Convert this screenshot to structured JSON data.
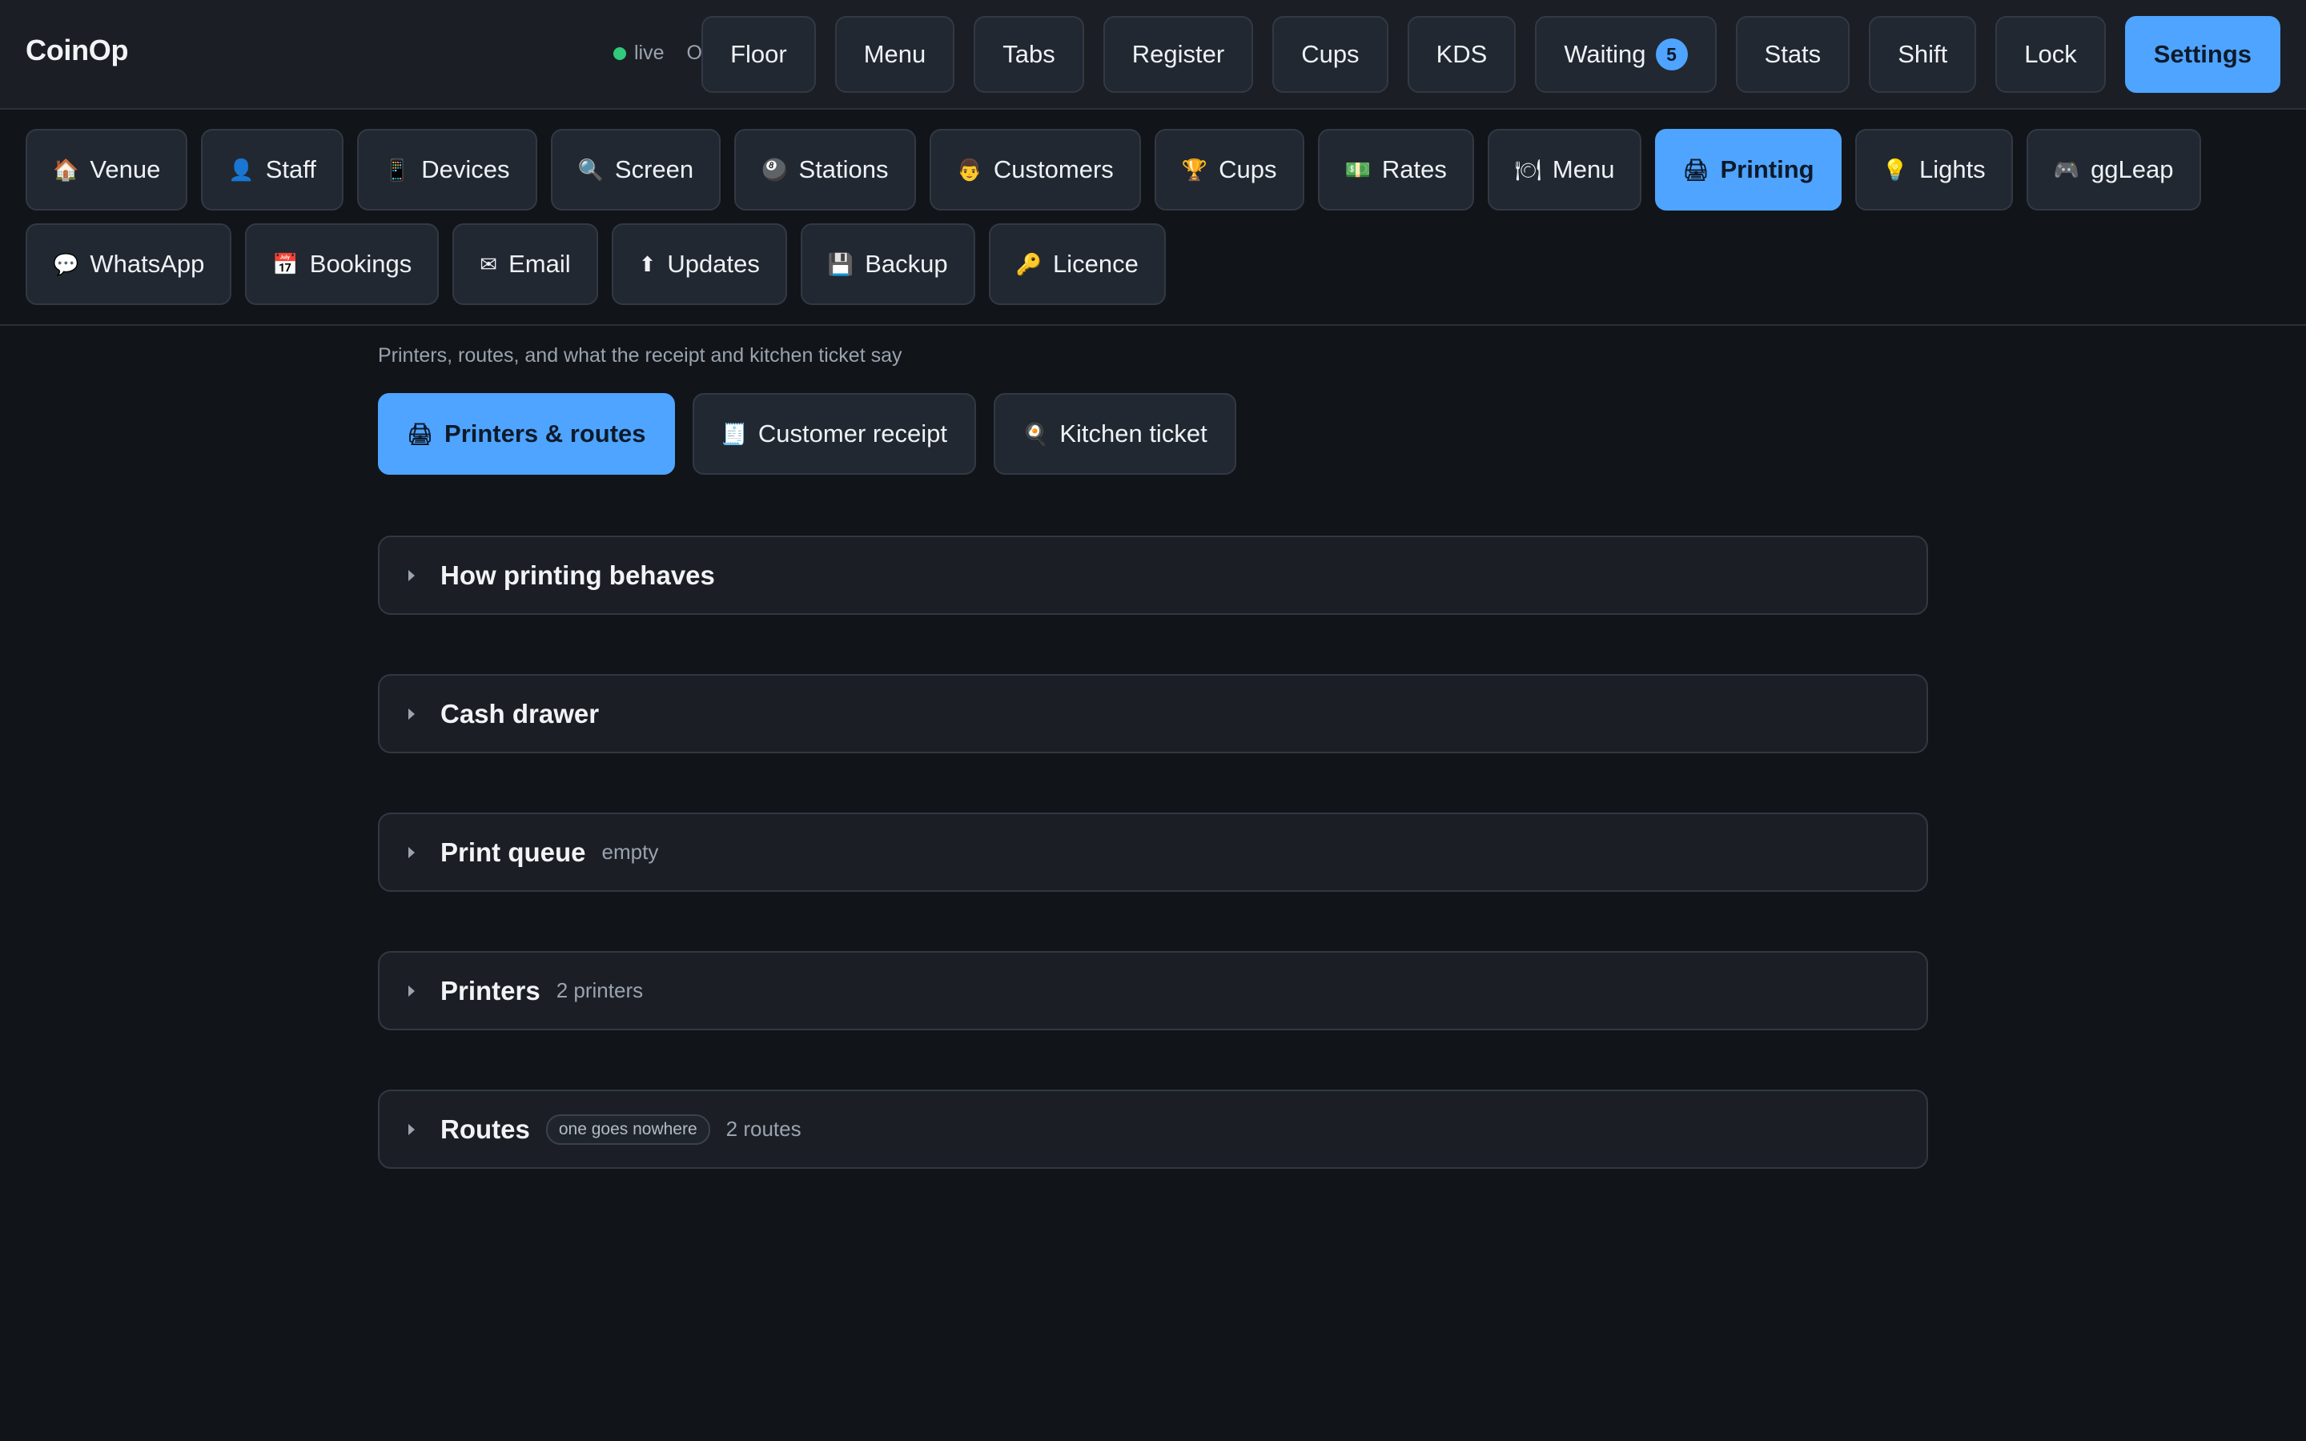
{
  "app": {
    "name": "CoinOp",
    "status": "live",
    "role": "Owner"
  },
  "topnav": [
    {
      "label": "Floor"
    },
    {
      "label": "Menu"
    },
    {
      "label": "Tabs"
    },
    {
      "label": "Register"
    },
    {
      "label": "Cups"
    },
    {
      "label": "KDS"
    },
    {
      "label": "Waiting",
      "badge": "5"
    },
    {
      "label": "Stats"
    },
    {
      "label": "Shift"
    },
    {
      "label": "Lock"
    },
    {
      "label": "Settings",
      "active": true
    }
  ],
  "settings_tabs": [
    {
      "icon": "🏠",
      "icon_name": "house-icon",
      "label": "Venue"
    },
    {
      "icon": "👤",
      "icon_name": "person-icon",
      "label": "Staff"
    },
    {
      "icon": "📱",
      "icon_name": "phone-icon",
      "label": "Devices"
    },
    {
      "icon": "🔍",
      "icon_name": "magnifier-icon",
      "label": "Screen"
    },
    {
      "icon": "🎱",
      "icon_name": "eight-ball-icon",
      "label": "Stations"
    },
    {
      "icon": "👨",
      "icon_name": "customer-face-icon",
      "label": "Customers"
    },
    {
      "icon": "🏆",
      "icon_name": "trophy-icon",
      "label": "Cups"
    },
    {
      "icon": "💵",
      "icon_name": "cash-icon",
      "label": "Rates"
    },
    {
      "icon": "🍽",
      "icon_name": "plate-icon",
      "label": "Menu"
    },
    {
      "icon": "🖨",
      "icon_name": "printer-icon",
      "label": "Printing",
      "active": true
    },
    {
      "icon": "💡",
      "icon_name": "bulb-icon",
      "label": "Lights"
    },
    {
      "icon": "🎮",
      "icon_name": "gamepad-icon",
      "label": "ggLeap"
    },
    {
      "icon": "💬",
      "icon_name": "speech-bubble-icon",
      "label": "WhatsApp"
    },
    {
      "icon": "📅",
      "icon_name": "calendar-icon",
      "label": "Bookings"
    },
    {
      "icon": "✉",
      "icon_name": "envelope-icon",
      "label": "Email"
    },
    {
      "icon": "⬆",
      "icon_name": "up-arrow-icon",
      "label": "Updates"
    },
    {
      "icon": "💾",
      "icon_name": "floppy-disk-icon",
      "label": "Backup"
    },
    {
      "icon": "🔑",
      "icon_name": "key-icon",
      "label": "Licence"
    }
  ],
  "printing": {
    "subtitle": "Printers, routes, and what the receipt and kitchen ticket say",
    "subtabs": [
      {
        "icon": "🖨",
        "icon_name": "printer-icon",
        "label": "Printers & routes",
        "active": true
      },
      {
        "icon": "🧾",
        "icon_name": "receipt-icon",
        "label": "Customer receipt"
      },
      {
        "icon": "🍳",
        "icon_name": "frying-pan-icon",
        "label": "Kitchen ticket"
      }
    ],
    "sections": [
      {
        "title": "How printing behaves",
        "meta": ""
      },
      {
        "title": "Cash drawer",
        "meta": ""
      },
      {
        "title": "Print queue",
        "meta": "empty"
      },
      {
        "title": "Printers",
        "meta": "2 printers"
      },
      {
        "title": "Routes",
        "pill": "one goes nowhere",
        "meta": "2 routes"
      }
    ]
  },
  "colors": {
    "accent": "#4ea4ff",
    "background": "#111418",
    "surface": "#222831",
    "status_live": "#2fca7a"
  }
}
